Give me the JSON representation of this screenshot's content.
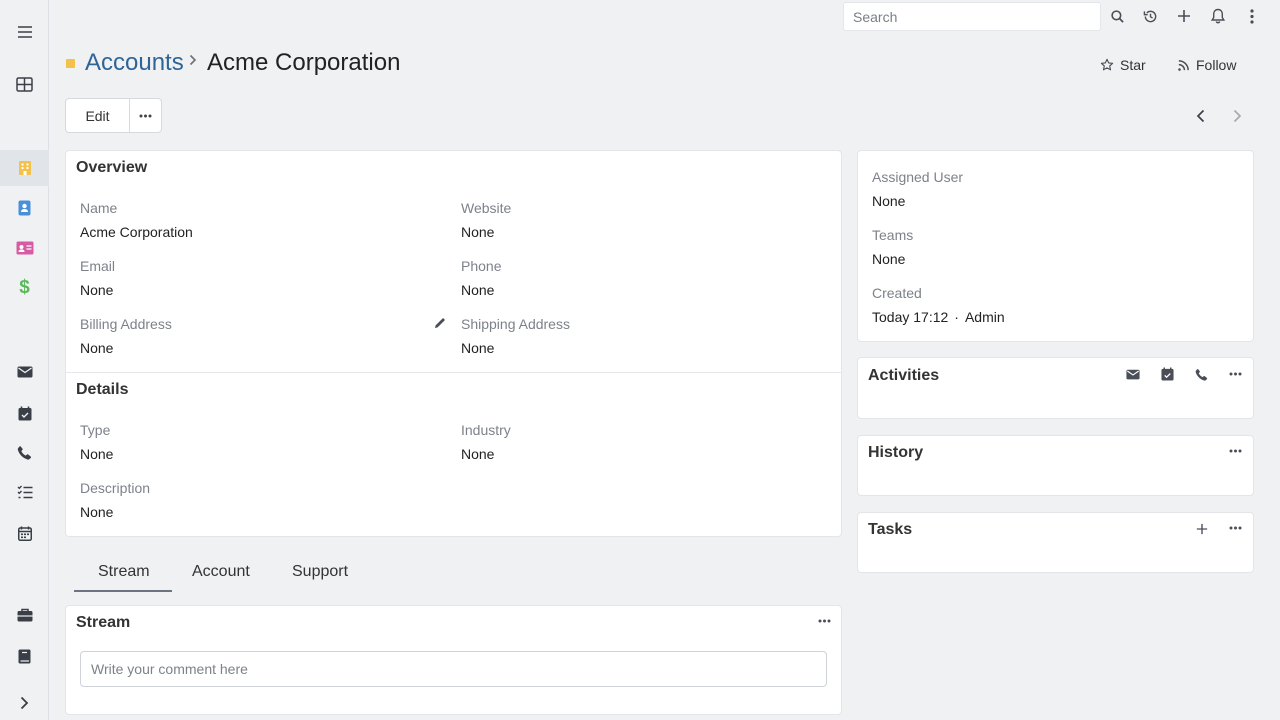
{
  "sidebar": {
    "items": [
      {
        "icon": "hamburger-menu-icon"
      },
      {
        "icon": "dashboard-grid-icon"
      },
      {
        "icon": "accounts-building-icon",
        "color": "#f4c24b",
        "active": true
      },
      {
        "icon": "contacts-icon",
        "color": "#4a90d9"
      },
      {
        "icon": "leads-id-card-icon",
        "color": "#d65aa4"
      },
      {
        "icon": "opportunities-dollar-icon",
        "color": "#5cb85c"
      },
      {
        "icon": "email-icon"
      },
      {
        "icon": "meetings-calendar-check-icon"
      },
      {
        "icon": "calls-phone-icon"
      },
      {
        "icon": "tasks-list-icon"
      },
      {
        "icon": "calendar-icon"
      },
      {
        "icon": "cases-briefcase-icon"
      },
      {
        "icon": "knowledge-base-book-icon"
      },
      {
        "icon": "expand-chevron-icon"
      }
    ]
  },
  "topbar": {
    "search_placeholder": "Search"
  },
  "header": {
    "breadcrumb_parent": "Accounts",
    "breadcrumb_current": "Acme Corporation",
    "star_label": "Star",
    "follow_label": "Follow",
    "edit_label": "Edit"
  },
  "overview": {
    "title": "Overview",
    "name_label": "Name",
    "name_value": "Acme Corporation",
    "website_label": "Website",
    "website_value": "None",
    "email_label": "Email",
    "email_value": "None",
    "phone_label": "Phone",
    "phone_value": "None",
    "billing_label": "Billing Address",
    "billing_value": "None",
    "shipping_label": "Shipping Address",
    "shipping_value": "None"
  },
  "details": {
    "title": "Details",
    "type_label": "Type",
    "type_value": "None",
    "industry_label": "Industry",
    "industry_value": "None",
    "description_label": "Description",
    "description_value": "None"
  },
  "side": {
    "assigned_label": "Assigned User",
    "assigned_value": "None",
    "teams_label": "Teams",
    "teams_value": "None",
    "created_label": "Created",
    "created_value": "Today 17:12",
    "created_separator": "·",
    "created_by": "Admin",
    "activities_title": "Activities",
    "history_title": "History",
    "tasks_title": "Tasks"
  },
  "tabs": [
    {
      "label": "Stream",
      "active": true
    },
    {
      "label": "Account",
      "active": false
    },
    {
      "label": "Support",
      "active": false
    }
  ],
  "stream": {
    "title": "Stream",
    "comment_placeholder": "Write your comment here"
  }
}
